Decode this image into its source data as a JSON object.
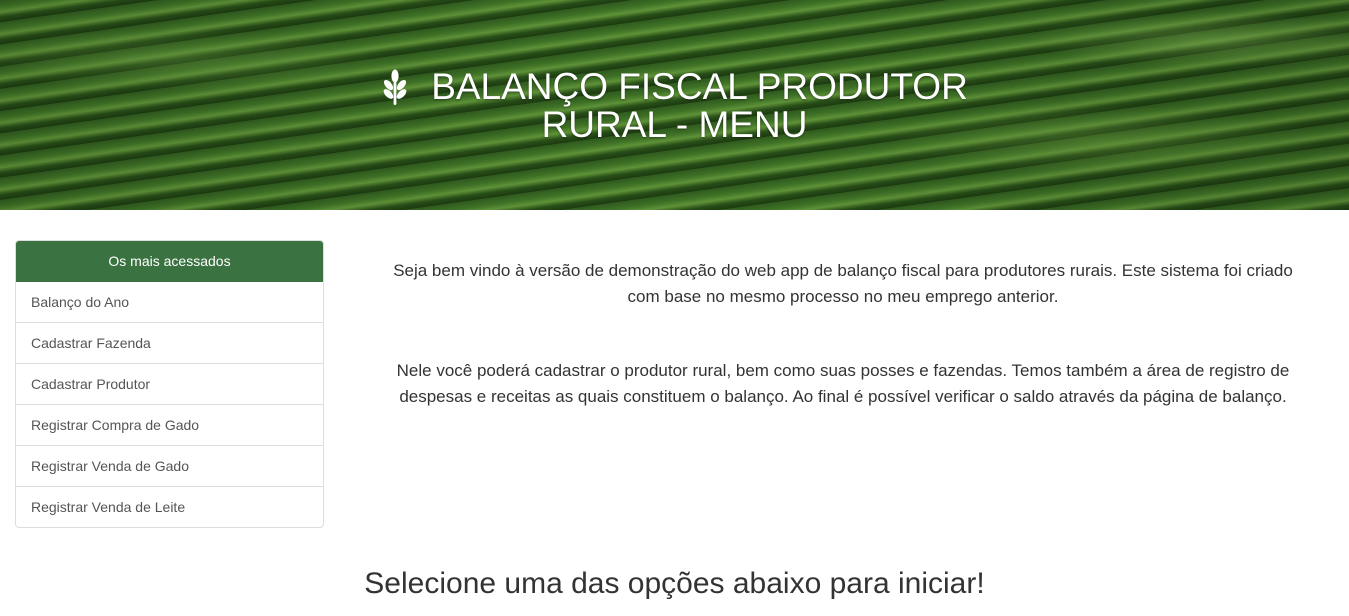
{
  "header": {
    "title_line1": "BALANÇO FISCAL PRODUTOR",
    "title_line2": "RURAL - MENU",
    "icon": "leaf-icon",
    "text_color": "#ffffff"
  },
  "sidebar": {
    "heading": "Os mais acessados",
    "heading_color": "#3a7341",
    "items": [
      {
        "label": "Balanço do Ano"
      },
      {
        "label": "Cadastrar Fazenda"
      },
      {
        "label": "Cadastrar Produtor"
      },
      {
        "label": "Registrar Compra de Gado"
      },
      {
        "label": "Registrar Venda de Gado"
      },
      {
        "label": "Registrar Venda de Leite"
      }
    ]
  },
  "main": {
    "paragraph1": "Seja bem vindo à versão de demonstração do web app de balanço fiscal para produtores rurais. Este sistema foi criado com base no mesmo processo no meu emprego anterior.",
    "paragraph2": "Nele você poderá cadastrar o produtor rural, bem como suas posses e fazendas. Temos também a área de registro de despesas e receitas as quais constituem o balanço. Ao final é possível verificar o saldo através da página de balanço.",
    "cta": "Selecione uma das opções abaixo para iniciar!"
  }
}
